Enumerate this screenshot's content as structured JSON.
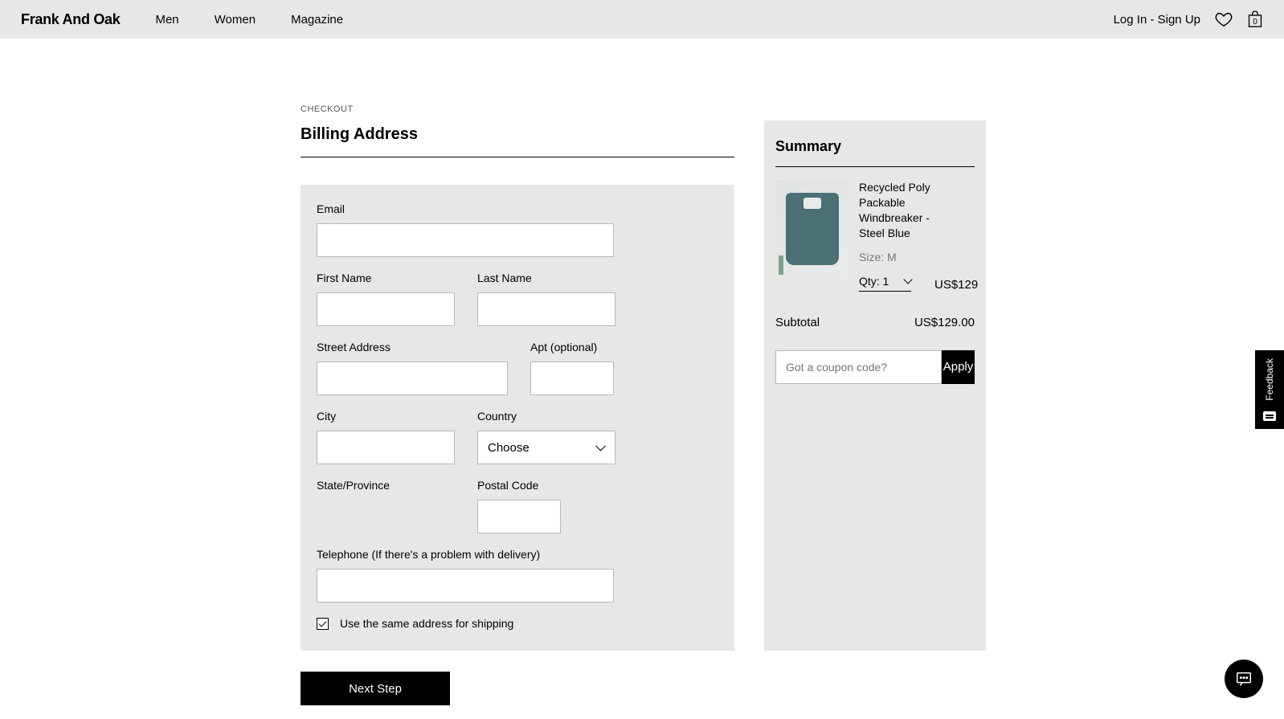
{
  "header": {
    "logo": "Frank And Oak",
    "nav": {
      "men": "Men",
      "women": "Women",
      "magazine": "Magazine"
    },
    "login": "Log In - Sign Up",
    "bag_count": "0"
  },
  "page": {
    "label": "CHECKOUT",
    "title": "Billing Address"
  },
  "form": {
    "email_label": "Email",
    "first_name_label": "First Name",
    "last_name_label": "Last Name",
    "street_label": "Street Address",
    "apt_label": "Apt (optional)",
    "city_label": "City",
    "country_label": "Country",
    "country_placeholder": "Choose",
    "state_label": "State/Province",
    "postal_label": "Postal Code",
    "telephone_label": "Telephone (If there's a problem with delivery)",
    "same_address_label": "Use the same address for shipping",
    "next_label": "Next Step"
  },
  "summary": {
    "title": "Summary",
    "item": {
      "name": "Recycled Poly Packable Windbreaker - Steel Blue",
      "size": "Size: M",
      "qty_label": "Qty: 1",
      "price": "US$129"
    },
    "subtotal_label": "Subtotal",
    "subtotal_value": "US$129.00",
    "coupon_placeholder": "Got a coupon code?",
    "apply_label": "Apply"
  },
  "feedback": "Feedback"
}
